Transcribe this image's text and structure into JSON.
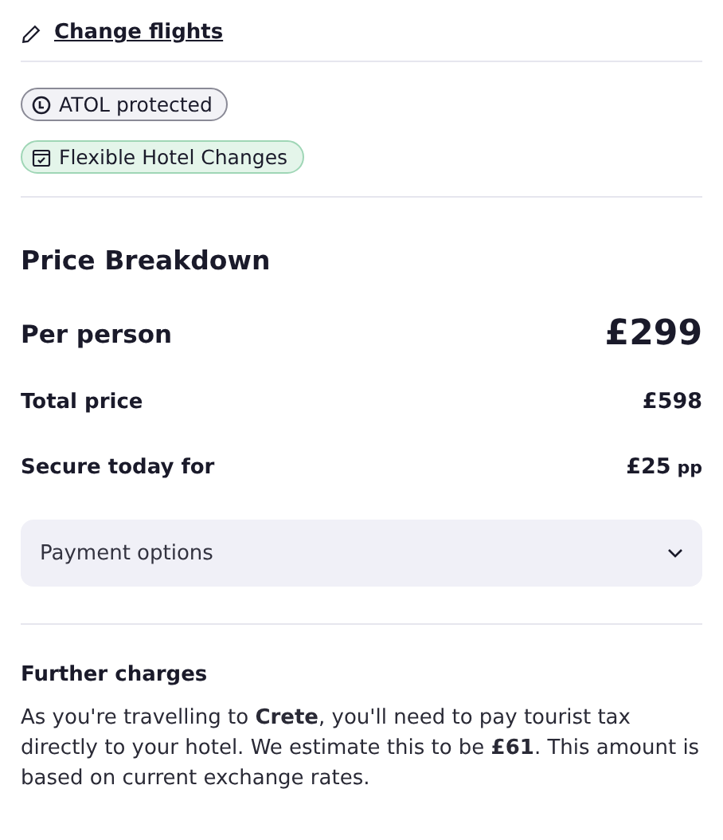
{
  "change_link": {
    "label": "Change flights"
  },
  "badges": [
    {
      "kind": "atol",
      "label": "ATOL protected"
    },
    {
      "kind": "flexible",
      "label": "Flexible Hotel Changes"
    }
  ],
  "price_breakdown": {
    "title": "Price Breakdown",
    "rows": [
      {
        "kind": "main",
        "label": "Per person",
        "value": "£299"
      },
      {
        "kind": "normal",
        "label": "Total price",
        "value": "£598"
      },
      {
        "kind": "normal",
        "label": "Secure today for",
        "value": "£25",
        "suffix": "pp"
      }
    ],
    "payment_dropdown": {
      "label": "Payment options",
      "expanded": false
    }
  },
  "further_charges": {
    "title": "Further charges",
    "text": "As you're travelling to **Crete**, you'll need to pay tourist tax directly to your hotel. We estimate this to be **£61**. This amount is based on current exchange rates."
  }
}
